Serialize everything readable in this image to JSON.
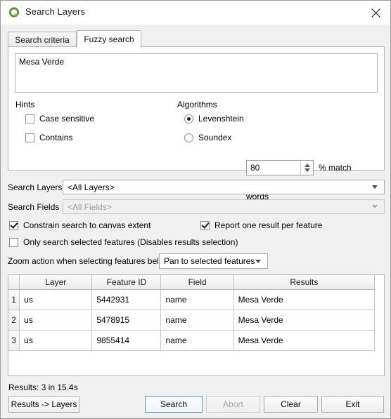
{
  "window": {
    "title": "Search Layers",
    "icon": "qgis-logo-icon",
    "close_icon": "close-icon"
  },
  "tabs": [
    {
      "label": "Search criteria",
      "active": false
    },
    {
      "label": "Fuzzy search",
      "active": true
    }
  ],
  "fuzzy_search": {
    "query_text": "Mesa Verde",
    "query_placeholder": "",
    "hints": {
      "group_label": "Hints",
      "options": [
        {
          "label": "Case sensitive",
          "checked": false
        },
        {
          "label": "Contains",
          "checked": false
        }
      ]
    },
    "algorithms": {
      "group_label": "Algorithms",
      "options": [
        {
          "label": "Levenshtein",
          "selected": true
        },
        {
          "label": "Soundex",
          "selected": false
        }
      ],
      "percent_match_value": "80",
      "percent_match_label": "% match",
      "soundex_note": "Exact match - best used for single words"
    }
  },
  "filters": {
    "search_layers_label": "Search Layers",
    "search_layers_value": "<All Layers>",
    "search_fields_label": "Search Fields",
    "search_fields_value": "<All Fields>",
    "search_fields_disabled": true
  },
  "options": [
    {
      "label": "Constrain search to canvas extent",
      "checked": true
    },
    {
      "label": "Report one result per feature",
      "checked": true
    },
    {
      "label": "Only search selected features (Disables results selection)",
      "checked": false
    }
  ],
  "zoom_action": {
    "label": "Zoom action when selecting features below",
    "value": "Pan to selected features"
  },
  "results_table": {
    "columns": [
      "Layer",
      "Feature ID",
      "Field",
      "Results"
    ],
    "rows": [
      {
        "num": "1",
        "layer": "us",
        "feature_id": "5442931",
        "field": "name",
        "result": "Mesa Verde"
      },
      {
        "num": "2",
        "layer": "us",
        "feature_id": "5478915",
        "field": "name",
        "result": "Mesa Verde"
      },
      {
        "num": "3",
        "layer": "us",
        "feature_id": "9855414",
        "field": "name",
        "result": "Mesa Verde"
      }
    ]
  },
  "status": "Results: 3 in 15.4s",
  "buttons": {
    "results_to_layers": "Results -> Layers",
    "search": "Search",
    "abort": "Abort",
    "clear": "Clear",
    "exit": "Exit"
  },
  "colors": {
    "accent_focus": "#4a9bdc",
    "logo_green": "#589632",
    "dialog_bg": "#f0f0f0"
  }
}
